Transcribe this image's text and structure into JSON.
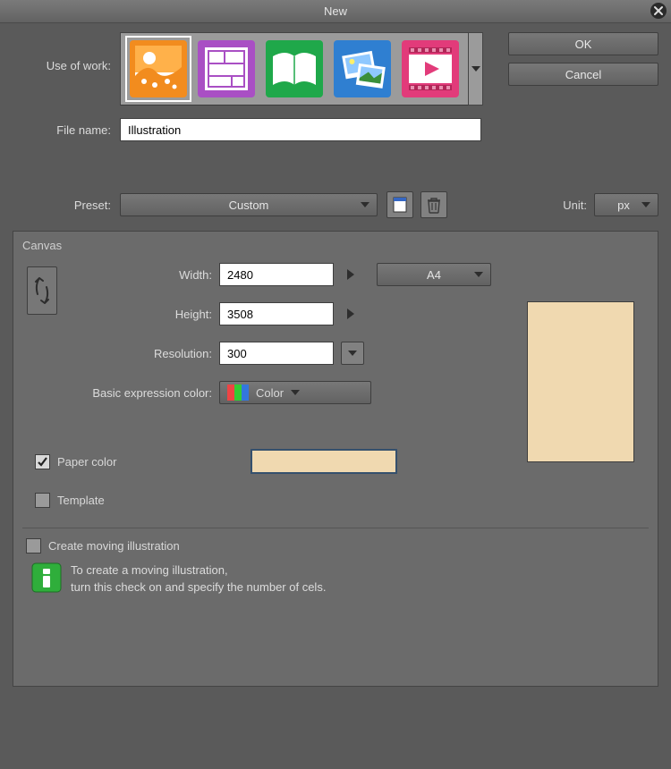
{
  "title": "New",
  "buttons": {
    "ok": "OK",
    "cancel": "Cancel"
  },
  "labels": {
    "use_of_work": "Use of work:",
    "file_name": "File name:",
    "preset": "Preset:",
    "unit": "Unit:",
    "canvas": "Canvas",
    "width": "Width:",
    "height": "Height:",
    "resolution": "Resolution:",
    "basic_expr": "Basic expression color:",
    "paper_color": "Paper color",
    "template": "Template",
    "create_moving": "Create moving illustration"
  },
  "values": {
    "file_name": "Illustration",
    "preset": "Custom",
    "unit": "px",
    "width": "2480",
    "height": "3508",
    "resolution": "300",
    "paper_size": "A4",
    "expr_color": "Color"
  },
  "checks": {
    "paper_color": true,
    "template": false,
    "create_moving": false
  },
  "colors": {
    "paper": "#f0d9b0"
  },
  "info": {
    "line1": "To create a moving illustration,",
    "line2": "turn this check on and specify the number of cels."
  },
  "work_types": [
    "illustration",
    "comic",
    "book",
    "photo",
    "animation"
  ]
}
